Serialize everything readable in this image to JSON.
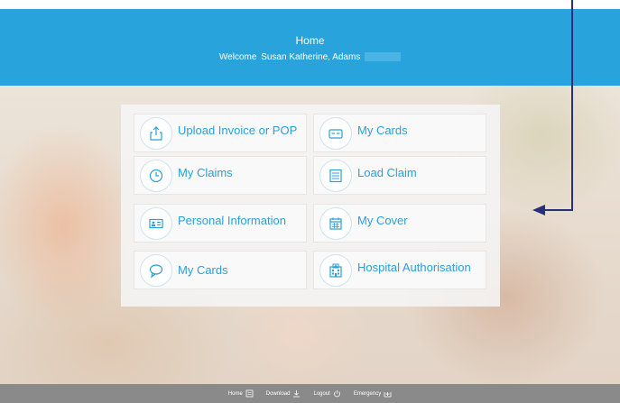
{
  "header": {
    "title": "Home",
    "welcome_prefix": "Welcome",
    "user_name": "Susan Katherine, Adams"
  },
  "tiles": [
    {
      "label": "Upload Invoice or POP",
      "icon": "upload-icon"
    },
    {
      "label": "My Cards",
      "icon": "card-icon"
    },
    {
      "label": "My Claims",
      "icon": "clock-icon"
    },
    {
      "label": "Load Claim",
      "icon": "form-list-icon"
    },
    {
      "label": "Personal Information",
      "icon": "id-card-icon"
    },
    {
      "label": "My Cover",
      "icon": "calendar-icon"
    },
    {
      "label": "My Cards",
      "icon": "chat-bubble-icon"
    },
    {
      "label": "Hospital Authorisation",
      "icon": "hospital-icon"
    }
  ],
  "footer": {
    "items": [
      {
        "label": "Home",
        "icon": "home-icon"
      },
      {
        "label": "Download",
        "icon": "download-icon"
      },
      {
        "label": "Logout",
        "icon": "power-icon"
      },
      {
        "label": "Emergency",
        "icon": "emergency-icon"
      }
    ]
  },
  "colors": {
    "header_bg": "#29a3dc",
    "accent": "#2b9fd8",
    "footer_bg": "#8a8a8a",
    "arrow": "#2a2f7a"
  }
}
